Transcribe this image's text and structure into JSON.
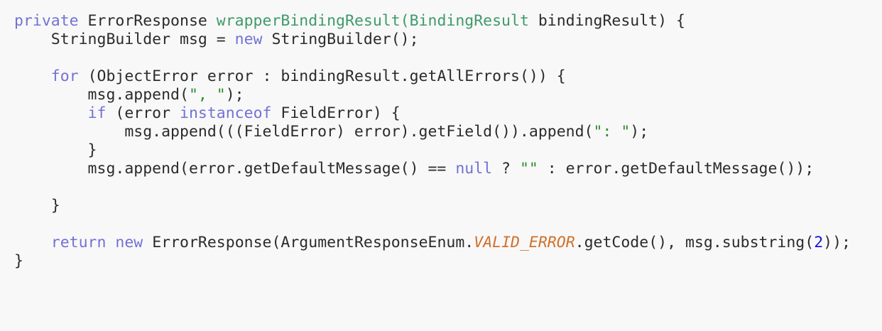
{
  "colors": {
    "background": "#f8f8f8",
    "text": "#2b2b2b",
    "keyword": "#7272d4",
    "method_decl": "#3f9a6a",
    "string": "#2e8b2e",
    "number": "#1414e0",
    "constant": "#d0702a"
  },
  "lines": [
    [
      {
        "t": "kw",
        "v": "private"
      },
      {
        "t": "plain",
        "v": " ErrorResponse "
      },
      {
        "t": "fn",
        "v": "wrapperBindingResult("
      },
      {
        "t": "fn",
        "v": "BindingResult"
      },
      {
        "t": "plain",
        "v": " bindingResult) {"
      }
    ],
    [
      {
        "t": "plain",
        "v": "    StringBuilder msg = "
      },
      {
        "t": "kw",
        "v": "new"
      },
      {
        "t": "plain",
        "v": " StringBuilder();"
      }
    ],
    [],
    [
      {
        "t": "plain",
        "v": "    "
      },
      {
        "t": "kw",
        "v": "for"
      },
      {
        "t": "plain",
        "v": " (ObjectError error : bindingResult.getAllErrors()) {"
      }
    ],
    [
      {
        "t": "plain",
        "v": "        msg.append("
      },
      {
        "t": "str",
        "v": "\", \""
      },
      {
        "t": "plain",
        "v": ");"
      }
    ],
    [
      {
        "t": "plain",
        "v": "        "
      },
      {
        "t": "kw",
        "v": "if"
      },
      {
        "t": "plain",
        "v": " (error "
      },
      {
        "t": "kw",
        "v": "instanceof"
      },
      {
        "t": "plain",
        "v": " FieldError) {"
      }
    ],
    [
      {
        "t": "plain",
        "v": "            msg.append(((FieldError) error).getField()).append("
      },
      {
        "t": "str",
        "v": "\": \""
      },
      {
        "t": "plain",
        "v": ");"
      }
    ],
    [
      {
        "t": "plain",
        "v": "        }"
      }
    ],
    [
      {
        "t": "plain",
        "v": "        msg.append(error.getDefaultMessage() == "
      },
      {
        "t": "kw",
        "v": "null"
      },
      {
        "t": "plain",
        "v": " ? "
      },
      {
        "t": "str",
        "v": "\"\""
      },
      {
        "t": "plain",
        "v": " : error.getDefaultMessage());"
      }
    ],
    [],
    [
      {
        "t": "plain",
        "v": "    }"
      }
    ],
    [],
    [
      {
        "t": "plain",
        "v": "    "
      },
      {
        "t": "kw",
        "v": "return"
      },
      {
        "t": "plain",
        "v": " "
      },
      {
        "t": "kw",
        "v": "new"
      },
      {
        "t": "plain",
        "v": " ErrorResponse(ArgumentResponseEnum."
      },
      {
        "t": "const",
        "v": "VALID_ERROR"
      },
      {
        "t": "plain",
        "v": ".getCode(), msg.substring("
      },
      {
        "t": "num",
        "v": "2"
      },
      {
        "t": "plain",
        "v": "));"
      }
    ],
    [
      {
        "t": "plain",
        "v": "}"
      }
    ]
  ]
}
